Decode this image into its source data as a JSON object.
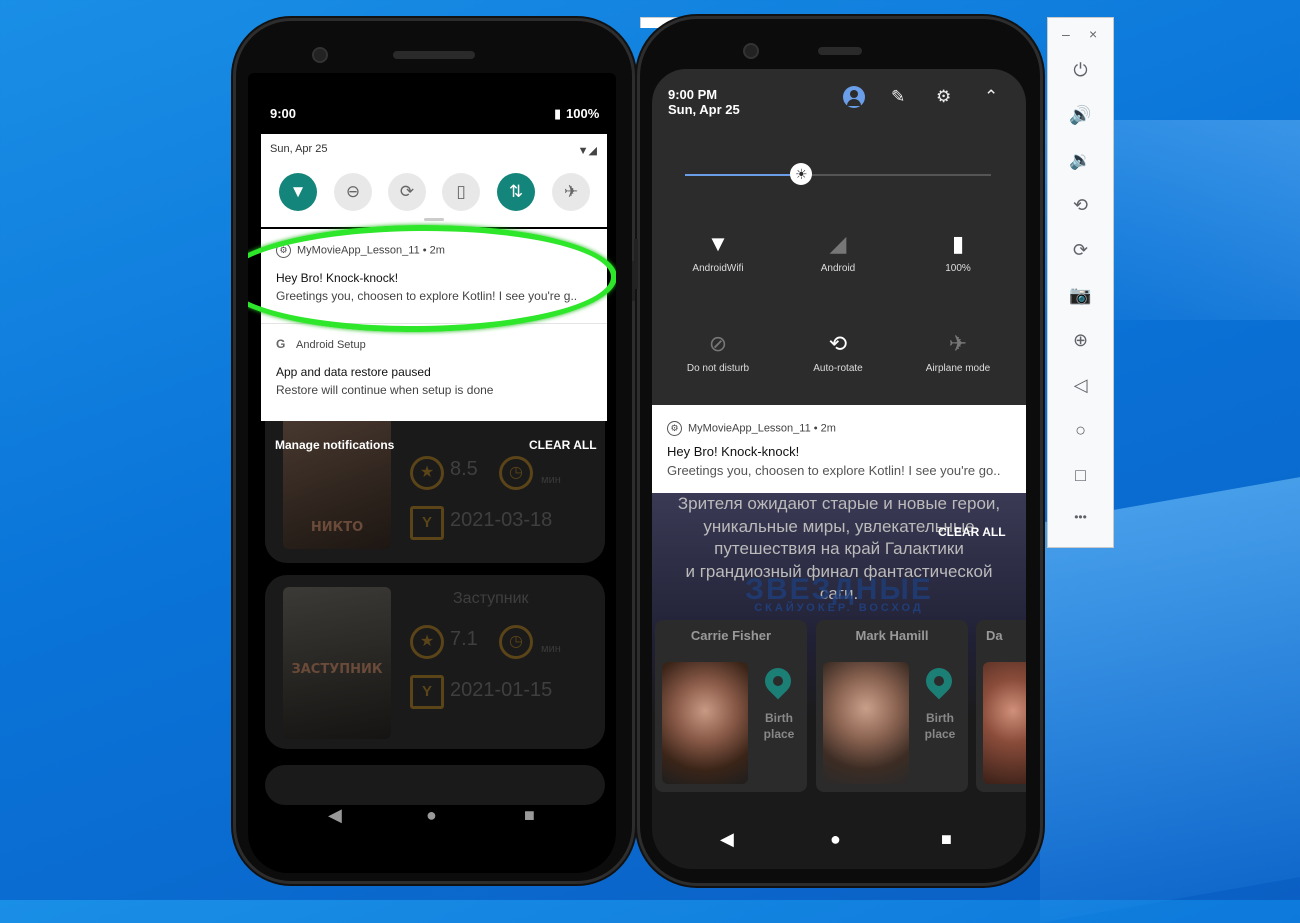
{
  "phone1": {
    "status": {
      "time": "9:00",
      "battery": "100%",
      "battery_icon": "battery-icon"
    },
    "quick_settings": {
      "date": "Sun, Apr 25",
      "tiles": [
        {
          "icon": "wifi-icon",
          "glyph": "▼",
          "on": true
        },
        {
          "icon": "do-not-disturb-icon",
          "glyph": "⊖",
          "on": false
        },
        {
          "icon": "auto-rotate-icon",
          "glyph": "⟳",
          "on": false
        },
        {
          "icon": "battery-saver-icon",
          "glyph": "▯",
          "on": false
        },
        {
          "icon": "data-icon",
          "glyph": "⇅",
          "on": true
        },
        {
          "icon": "airplane-icon",
          "glyph": "✈",
          "on": false
        }
      ]
    },
    "notifications": [
      {
        "app": "MyMovieApp_Lesson_11 • 2m",
        "title": "Hey Bro! Knock-knock!",
        "text": "Greetings you, choosen to explore Kotlin! I see you're g.."
      },
      {
        "app": "Android Setup",
        "title": "App and data restore paused",
        "text": "Restore will continue when setup is done"
      }
    ],
    "manage": "Manage notifications",
    "clear_all": "CLEAR ALL",
    "movies": [
      {
        "poster_text": "НИКТО",
        "rating": "8.5",
        "minutes_label": "мин",
        "date": "2021-03-18"
      },
      {
        "title": "Заступник",
        "poster_text": "ЗАСТУПНИК",
        "rating": "7.1",
        "minutes_label": "мин",
        "date": "2021-01-15"
      }
    ],
    "nav": {
      "back": "◀",
      "home": "●",
      "recents": "■"
    }
  },
  "phone2": {
    "time": "9:00 PM",
    "date": "Sun, Apr 25",
    "brightness": 0.38,
    "tiles": [
      {
        "label": "AndroidWifi",
        "glyph": "▼",
        "on": true
      },
      {
        "label": "Android",
        "glyph": "◢",
        "on": false
      },
      {
        "label": "100%",
        "glyph": "▮",
        "on": true
      },
      {
        "label": "Do not disturb",
        "glyph": "⊘",
        "on": false
      },
      {
        "label": "Auto-rotate",
        "glyph": "⟲",
        "on": true
      },
      {
        "label": "Airplane mode",
        "glyph": "✈",
        "on": false
      }
    ],
    "notification": {
      "app": "MyMovieApp_Lesson_11 • 2m",
      "title": "Hey Bro! Knock-knock!",
      "text": "Greetings you, choosen to explore Kotlin! I see you're go.."
    },
    "clear_all": "CLEAR ALL",
    "description": [
      "Зрителя ожидают старые и новые герои,",
      "уникальные миры, увлекательные",
      "путешествия на край Галактики",
      "и грандиозный финал фантастической",
      "саги."
    ],
    "poster_title": "ЗВЕЗДНЫЕ",
    "poster_subtitle": "СКАЙУОКЕР. ВОСХОД",
    "actors": [
      {
        "name": "Carrie Fisher",
        "birth": "Birth place"
      },
      {
        "name": "Mark Hamill",
        "birth": "Birth place"
      },
      {
        "name": "Da",
        "birth": ""
      }
    ],
    "nav": {
      "back": "◀",
      "home": "●",
      "recents": "■"
    }
  },
  "toolbar": {
    "minimize": "–",
    "close": "×",
    "buttons": [
      {
        "icon": "power-icon",
        "glyph": "⏻"
      },
      {
        "icon": "volume-up-icon",
        "glyph": "🔊"
      },
      {
        "icon": "volume-down-icon",
        "glyph": "🔉"
      },
      {
        "icon": "rotate-left-icon",
        "glyph": "⟲"
      },
      {
        "icon": "rotate-right-icon",
        "glyph": "⟳"
      },
      {
        "icon": "camera-icon",
        "glyph": "📷"
      },
      {
        "icon": "zoom-icon",
        "glyph": "⊕"
      },
      {
        "icon": "back-icon",
        "glyph": "◁"
      },
      {
        "icon": "home-icon",
        "glyph": "○"
      },
      {
        "icon": "overview-icon",
        "glyph": "□"
      },
      {
        "icon": "more-icon",
        "glyph": "•••"
      }
    ]
  }
}
